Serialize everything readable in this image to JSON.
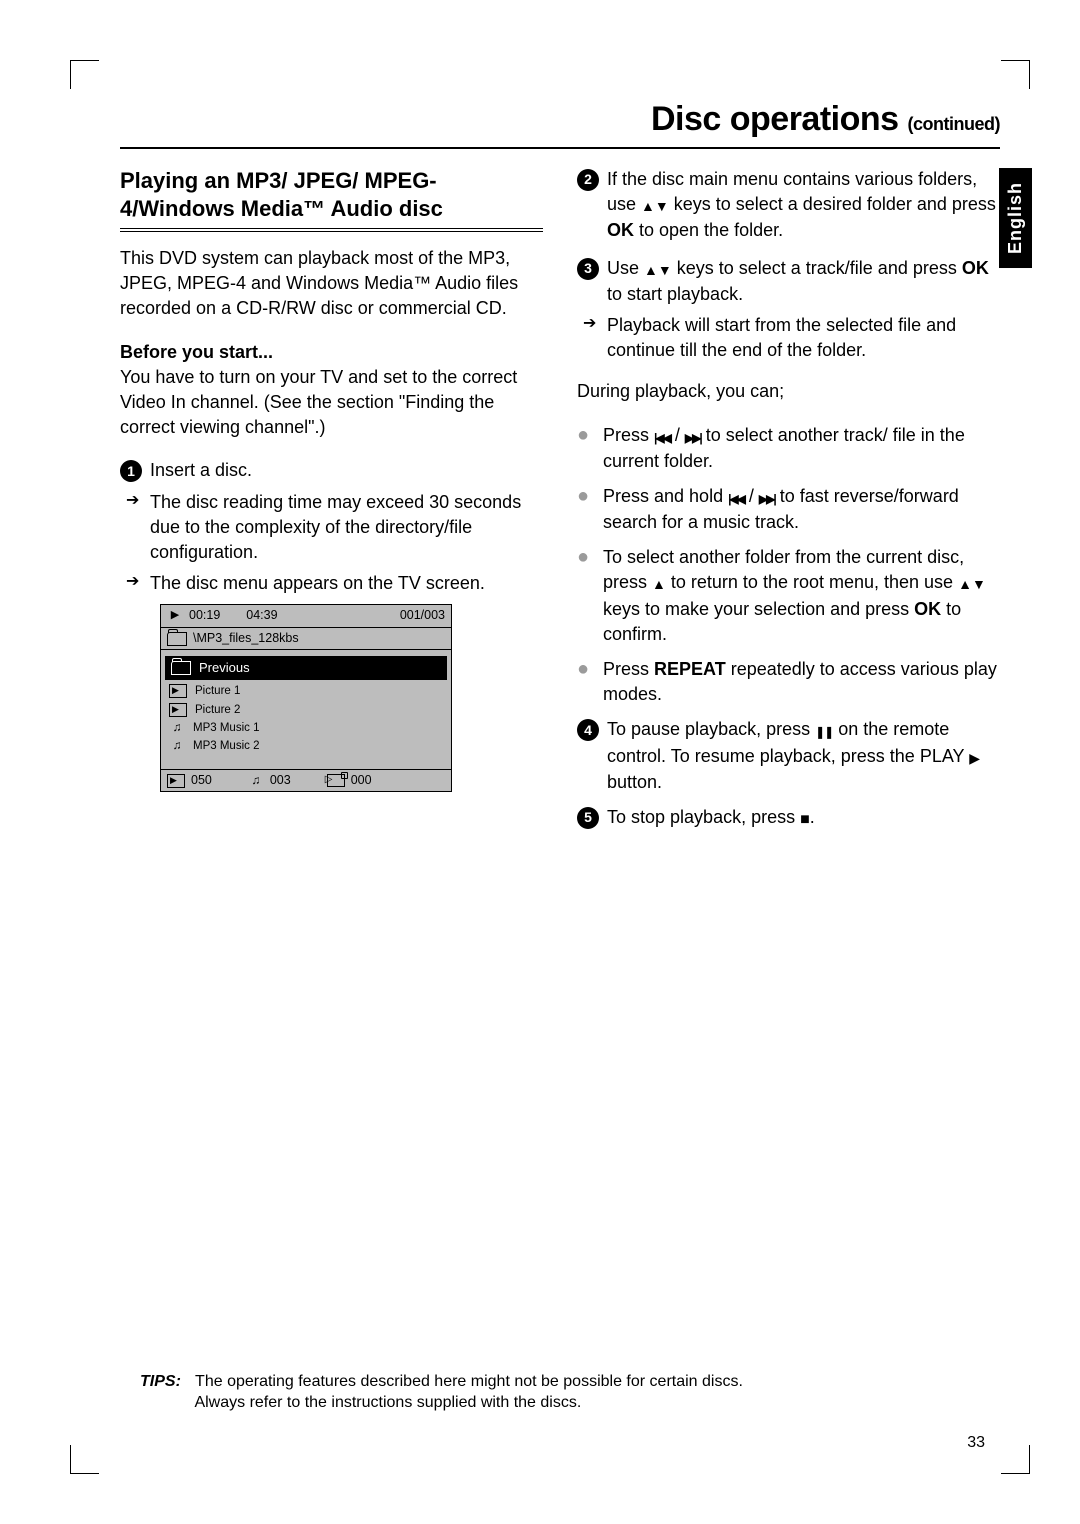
{
  "language_tab": "English",
  "page_number": "33",
  "title": {
    "main": "Disc operations",
    "suffix": "(continued)"
  },
  "section_heading": "Playing an MP3/ JPEG/ MPEG-4/Windows Media™ Audio disc",
  "intro": "This DVD system can playback most of the MP3, JPEG, MPEG-4 and Windows Media™ Audio files recorded on a CD-R/RW disc or commercial CD.",
  "before_label": "Before you start...",
  "before_text": "You have to turn on your TV and set to the correct Video In channel.  (See the section \"Finding the correct viewing channel\".)",
  "step1": {
    "text": "Insert a disc.",
    "arrow1": "The disc reading time may exceed 30 seconds due to the complexity of the directory/file configuration.",
    "arrow2": "The disc menu appears on the TV screen."
  },
  "osd": {
    "top": {
      "time_elapsed": "00:19",
      "time_total": "04:39",
      "track_index": "001/003"
    },
    "path": "\\MP3_files_128kbs",
    "previous": "Previous",
    "items": [
      {
        "icon": "pic",
        "label": "Picture 1"
      },
      {
        "icon": "pic",
        "label": "Picture 2"
      },
      {
        "icon": "music",
        "label": "MP3 Music 1"
      },
      {
        "icon": "music",
        "label": "MP3 Music 2"
      }
    ],
    "footer": {
      "pic_count": "050",
      "music_count": "003",
      "video_count": "000"
    }
  },
  "step2_a": "If the disc main menu contains various folders, use ",
  "step2_b": " keys to select a desired folder and press ",
  "step2_ok": "OK",
  "step2_c": " to open the folder.",
  "step3_a": "Use ",
  "step3_b": " keys to select a track/file and press ",
  "step3_ok": "OK",
  "step3_c": " to start playback.",
  "step3_arrow": "Playback will start from the selected file and continue till the end of the folder.",
  "during": "During playback, you can;",
  "bullets": {
    "b1_a": "Press ",
    "b1_b": " to select another track/ file in the current folder.",
    "b2_a": "Press and hold ",
    "b2_b": " to fast reverse/forward search for a music track.",
    "b3_a": "To select another folder from the current disc, press ",
    "b3_b": " to return to the root menu, then use ",
    "b3_c": " keys to make your selection and press ",
    "b3_ok": "OK",
    "b3_d": " to confirm.",
    "b4_a": "Press ",
    "b4_repeat": "REPEAT",
    "b4_b": " repeatedly to access various play modes."
  },
  "step4_a": "To pause playback, press ",
  "step4_b": " on the remote control. To resume playback, press the PLAY ",
  "step4_c": " button.",
  "step5_a": "To stop playback, press ",
  "step5_b": ".",
  "tips": {
    "label": "TIPS:",
    "line1": "The operating features described here might not be possible for certain discs.",
    "line2": "Always refer to the instructions supplied with the discs."
  }
}
